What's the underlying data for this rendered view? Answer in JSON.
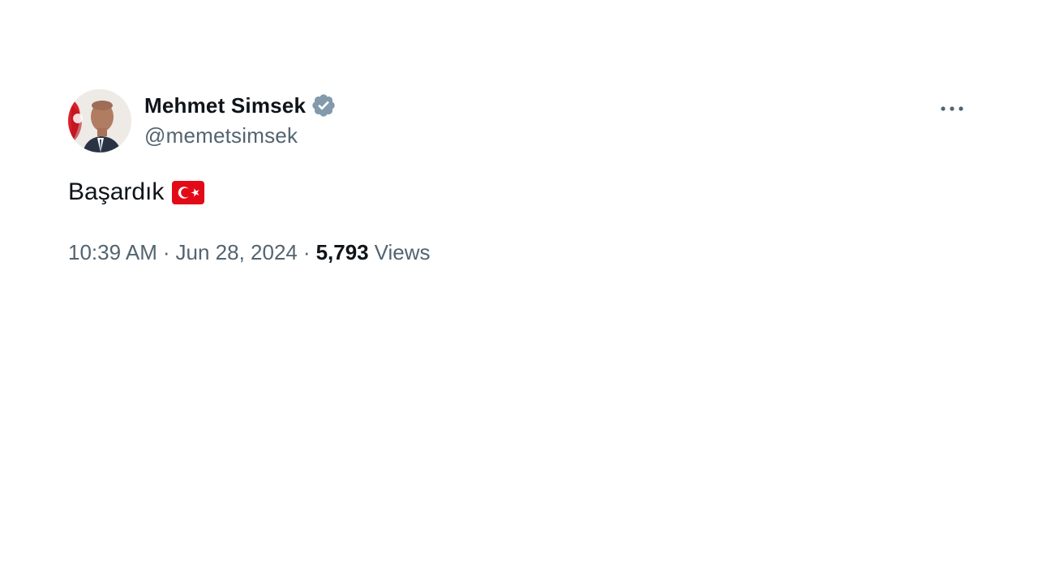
{
  "author": {
    "display_name": "Mehmet Simsek",
    "handle": "@memetsimsek",
    "verified_badge": "verified-badge-icon",
    "badge_color": "#829aab"
  },
  "tweet": {
    "text": "Başardık",
    "emoji": "turkey-flag-icon",
    "flag_color": "#e30a17"
  },
  "meta": {
    "time": "10:39 AM",
    "separator": "·",
    "date": "Jun 28, 2024",
    "views_count": "5,793",
    "views_label": "Views"
  },
  "actions": {
    "more_icon": "more-options-icon"
  },
  "colors": {
    "text_primary": "#0f1419",
    "text_secondary": "#536471"
  }
}
